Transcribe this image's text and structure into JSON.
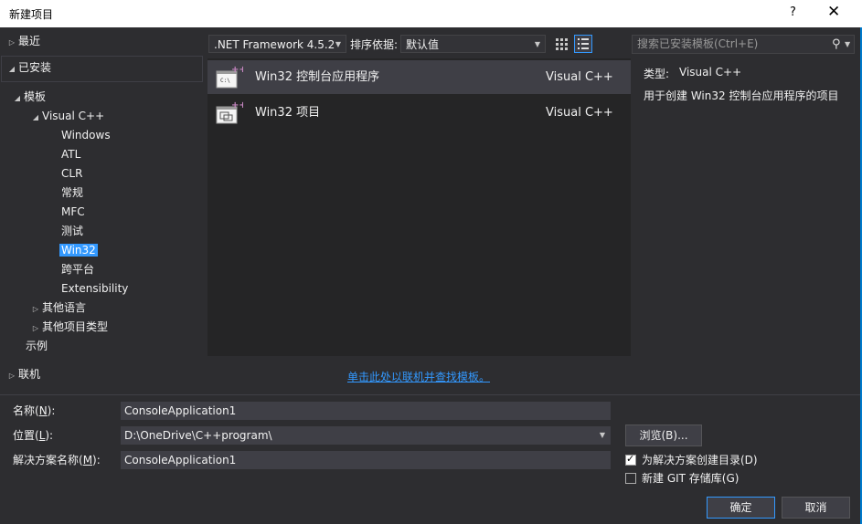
{
  "window": {
    "title": "新建项目",
    "help": "?",
    "close": "✕"
  },
  "nav": {
    "recent": "最近",
    "installed": "已安装",
    "templates": "模板",
    "visual_cpp": "Visual C++",
    "children": [
      "Windows",
      "ATL",
      "CLR",
      "常规",
      "MFC",
      "测试",
      "Win32",
      "跨平台",
      "Extensibility"
    ],
    "other_languages": "其他语言",
    "other_project_types": "其他项目类型",
    "samples": "示例",
    "online": "联机"
  },
  "toolbar": {
    "framework": ".NET Framework 4.5.2",
    "sort_label": "排序依据:",
    "sort_value": "默认值",
    "search_placeholder": "搜索已安装模板(Ctrl+E)"
  },
  "templates": [
    {
      "name": "Win32 控制台应用程序",
      "lang": "Visual C++",
      "icon": "console-app-icon",
      "selected": true
    },
    {
      "name": "Win32 项目",
      "lang": "Visual C++",
      "icon": "win32-project-icon",
      "selected": false
    }
  ],
  "description": {
    "type_label": "类型:",
    "type_value": "Visual C++",
    "text": "用于创建 Win32 控制台应用程序的项目"
  },
  "online_link": "单击此处以联机并查找模板。",
  "form": {
    "name_label": "名称(",
    "name_key": "N",
    "name_end": "):",
    "name_value": "ConsoleApplication1",
    "location_label": "位置(",
    "location_key": "L",
    "location_end": "):",
    "location_value": "D:\\OneDrive\\C++program\\",
    "solution_label": "解决方案名称(",
    "solution_key": "M",
    "solution_end": "):",
    "solution_value": "ConsoleApplication1",
    "browse_label": "浏览(B)...",
    "create_dir_label": "为解决方案创建目录(D)",
    "create_dir_checked": true,
    "git_label": "新建 GIT 存储库(G)",
    "git_checked": false,
    "ok": "确定",
    "cancel": "取消"
  }
}
